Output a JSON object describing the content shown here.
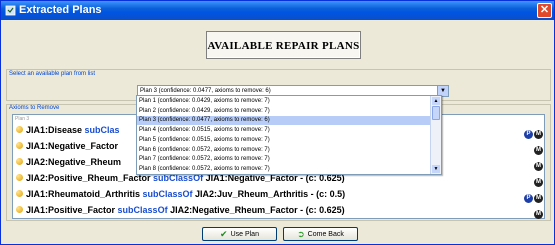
{
  "window": {
    "title": "Extracted Plans",
    "close_icon": "close-icon"
  },
  "header": {
    "title": "AVAILABLE REPAIR PLANS"
  },
  "plan_select": {
    "label": "Select an available plan from list",
    "selected": "Plan 3 (confidence: 0.0477, axioms to remove: 6)",
    "options": [
      "Plan 1 (confidence: 0.0429, axioms to remove: 7)",
      "Plan 2 (confidence: 0.0429, axioms to remove: 7)",
      "Plan 3 (confidence: 0.0477, axioms to remove: 6)",
      "Plan 4 (confidence: 0.0515, axioms to remove: 7)",
      "Plan 5 (confidence: 0.0515, axioms to remove: 7)",
      "Plan 6 (confidence: 0.0572, axioms to remove: 7)",
      "Plan 7 (confidence: 0.0572, axioms to remove: 7)",
      "Plan 8 (confidence: 0.0572, axioms to remove: 7)"
    ],
    "highlighted_index": 2
  },
  "axioms": {
    "label": "Axioms to Remove",
    "list_header": "Plan 3",
    "rows": [
      {
        "left": "JIA1:Disease ",
        "kw": "subClas",
        "right": "",
        "badges": [
          "P",
          "M"
        ]
      },
      {
        "left": "JIA1:Negative_Factor",
        "kw": "",
        "right": "",
        "badges": [
          "M"
        ]
      },
      {
        "left": "JIA2:Negative_Rheum",
        "kw": "",
        "right": "",
        "badges": [
          "M"
        ]
      },
      {
        "left": "JIA2:Positive_Rheum_Factor ",
        "kw": "subClassOf",
        "right": " JIA1:Negative_Factor   -   (c: 0.625)",
        "badges": [
          "M"
        ]
      },
      {
        "left": "JIA1:Rheumatoid_Arthritis ",
        "kw": "subClassOf",
        "right": " JIA2:Juv_Rheum_Arthritis   -   (c: 0.5)",
        "badges": [
          "P",
          "M"
        ]
      },
      {
        "left": "JIA1:Positive_Factor ",
        "kw": "subClassOf",
        "right": " JIA2:Negative_Rheum_Factor   -   (c: 0.625)",
        "badges": [
          "M"
        ]
      }
    ]
  },
  "buttons": {
    "use_plan": "Use Plan",
    "come_back": "Come Back"
  },
  "colors": {
    "titlebar": "#0054e3",
    "keyword": "#1a4ed0",
    "selection": "#b7cdf7"
  }
}
